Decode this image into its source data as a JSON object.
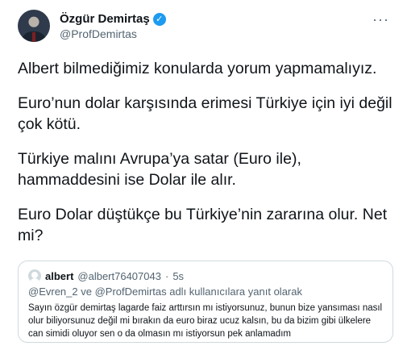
{
  "author": {
    "name": "Özgür Demirtaş",
    "handle": "@ProfDemirtas",
    "verified_glyph": "✓"
  },
  "menu": {
    "more_label": "···"
  },
  "tweet": {
    "paragraphs": [
      "Albert bilmediğimiz konularda yorum yapmamalıyız.",
      "Euro’nun dolar karşısında erimesi Türkiye için iyi değil çok kötü.",
      "Türkiye malını Avrupa’ya satar (Euro ile), hammaddesini ise Dolar ile alır.",
      "Euro Dolar düştükçe bu Türkiye’nin zararına olur. Net mi?"
    ]
  },
  "quoted": {
    "name": "albert",
    "handle": "@albert76407043",
    "separator": "·",
    "time": "5s",
    "reply_context": "@Evren_2 ve @ProfDemirtas adlı kullanıcılara yanıt olarak",
    "text": "Sayın özgür demirtaş lagarde faiz arttırsın mı istiyorsunuz, bunun bize yansıması nasıl olur biliyorsunuz değil mi bırakın da euro biraz ucuz kalsın, bu da bizim gibi ülkelere can simidi oluyor sen o da olmasın mı istiyorsun pek anlamadım"
  },
  "colors": {
    "accent": "#1d9bf0",
    "text": "#0f1419",
    "secondary": "#536471",
    "border": "#cfd9de"
  },
  "icons": [
    "verified-badge-icon",
    "more-options-icon",
    "user-avatar-icon"
  ]
}
